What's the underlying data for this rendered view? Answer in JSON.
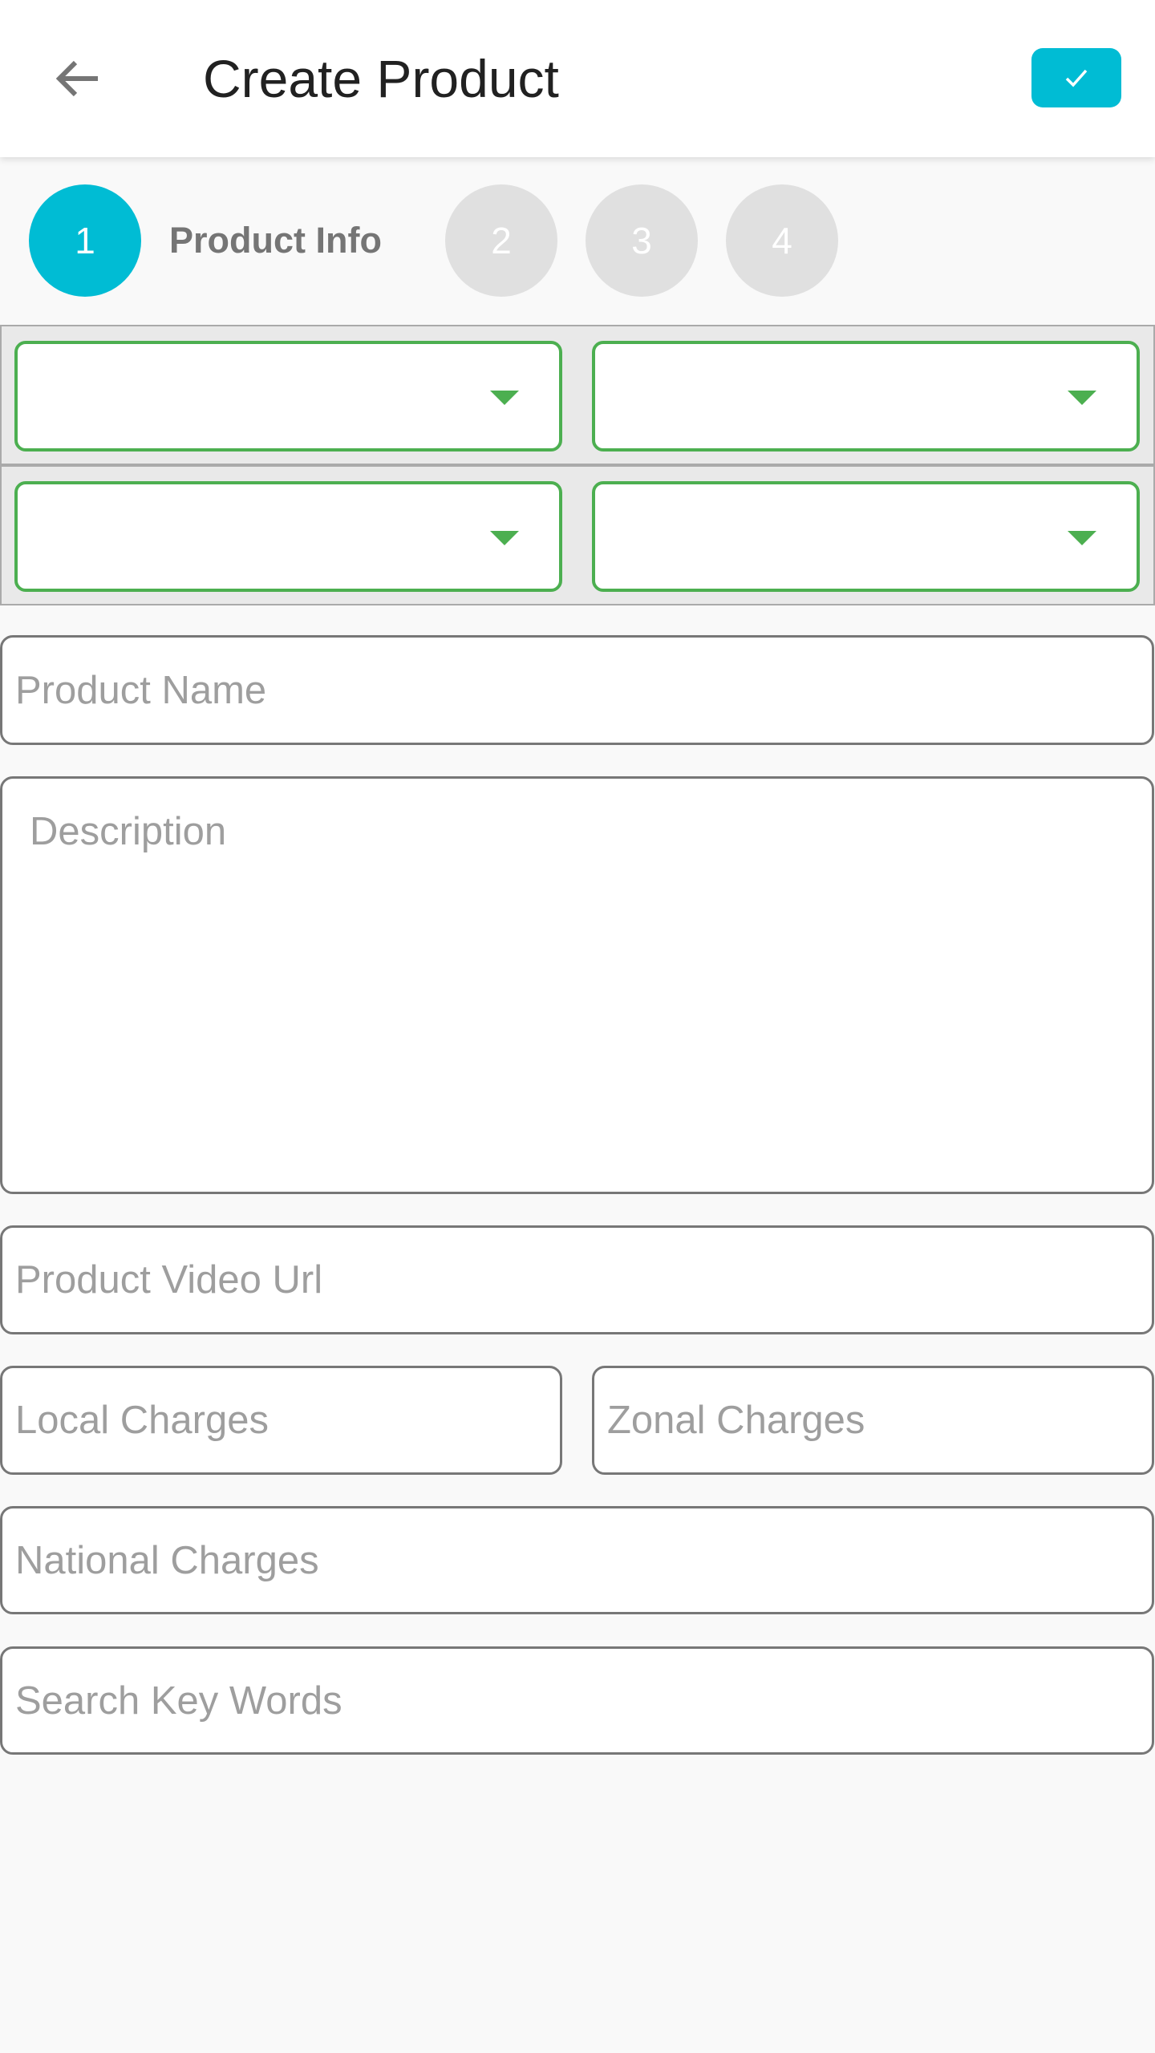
{
  "header": {
    "title": "Create Product",
    "back_icon": "arrow-left-icon",
    "confirm_icon": "check-icon"
  },
  "colors": {
    "accent": "#00bcd4",
    "dropdown_border": "#4caf50",
    "inactive_step": "#e0e0e0"
  },
  "stepper": {
    "steps": [
      {
        "number": "1",
        "label": "Product Info",
        "active": true
      },
      {
        "number": "2"
      },
      {
        "number": "3"
      },
      {
        "number": "4"
      }
    ]
  },
  "form": {
    "product_name": {
      "placeholder": "Product Name",
      "value": ""
    },
    "description": {
      "placeholder": "Description",
      "value": ""
    },
    "video_url": {
      "placeholder": "Product Video Url",
      "value": ""
    },
    "local_charges": {
      "placeholder": "Local Charges",
      "value": ""
    },
    "zonal_charges": {
      "placeholder": "Zonal Charges",
      "value": ""
    },
    "national_charges": {
      "placeholder": "National Charges",
      "value": ""
    },
    "search_keywords": {
      "placeholder": "Search Key Words",
      "value": ""
    }
  }
}
